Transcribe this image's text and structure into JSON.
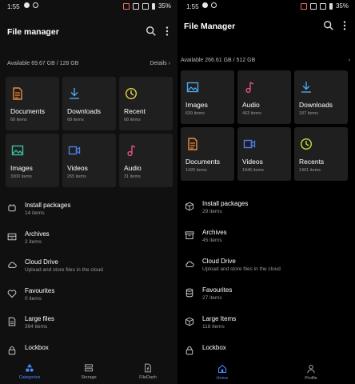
{
  "left": {
    "status": {
      "time": "1:55",
      "battery": "35%"
    },
    "title": "File manager",
    "storage": {
      "available": "Available 69.67 GB / 128 GB",
      "details": "Details ›"
    },
    "tiles": [
      {
        "label": "Documents",
        "count": "68 items",
        "icon": "document-icon",
        "color": "#f08a3a"
      },
      {
        "label": "Downloads",
        "count": "68 items",
        "icon": "download-icon",
        "color": "#4fa6e8"
      },
      {
        "label": "Recent",
        "count": "68 items",
        "icon": "clock-icon",
        "color": "#e3d44a"
      },
      {
        "label": "Images",
        "count": "3300 items",
        "icon": "image-icon",
        "color": "#3cc0a0"
      },
      {
        "label": "Videos",
        "count": "255 items",
        "icon": "video-icon",
        "color": "#4f7fe8"
      },
      {
        "label": "Audio",
        "count": "31 items",
        "icon": "music-icon",
        "color": "#e84f8a"
      }
    ],
    "list": [
      {
        "title": "Install packages",
        "sub": "14 items",
        "icon": "package-icon"
      },
      {
        "title": "Archives",
        "sub": "2 items",
        "icon": "archive-icon"
      },
      {
        "title": "Cloud Drive",
        "sub": "Upload and store files in the cloud",
        "icon": "cloud-icon"
      },
      {
        "title": "Favourites",
        "sub": "0 items",
        "icon": "heart-icon"
      },
      {
        "title": "Large files",
        "sub": "394 items",
        "icon": "file-icon"
      },
      {
        "title": "Lockbox",
        "sub": "",
        "icon": "lock-icon"
      }
    ],
    "nav": [
      {
        "label": "Categories",
        "icon": "categories-icon",
        "active": true
      },
      {
        "label": "Storage",
        "icon": "storage-icon",
        "active": false
      },
      {
        "label": "FileDash",
        "icon": "filedash-icon",
        "active": false
      }
    ]
  },
  "right": {
    "status": {
      "time": "1:55",
      "battery": "35%"
    },
    "title": "File Manager",
    "storage": {
      "available": "Available 266.61 GB / 512 GB",
      "details": "›"
    },
    "tiles": [
      {
        "label": "Images",
        "count": "639 items",
        "icon": "image-icon",
        "color": "#4fa6e8"
      },
      {
        "label": "Audio",
        "count": "463 items",
        "icon": "music-icon",
        "color": "#e84f8a"
      },
      {
        "label": "Downloads",
        "count": "187 items",
        "icon": "download-icon",
        "color": "#4fa6e8"
      },
      {
        "label": "Documents",
        "count": "1420 items",
        "icon": "document-icon",
        "color": "#f08a3a"
      },
      {
        "label": "Videos",
        "count": "1946 items",
        "icon": "video-icon",
        "color": "#4f7fe8"
      },
      {
        "label": "Recents",
        "count": "1461 items",
        "icon": "clock-icon",
        "color": "#c6e03a"
      }
    ],
    "list": [
      {
        "title": "Install packages",
        "sub": "29 items",
        "icon": "package-icon"
      },
      {
        "title": "Archives",
        "sub": "45 items",
        "icon": "archive-icon"
      },
      {
        "title": "Cloud Drive",
        "sub": "Upload and store files in the cloud",
        "icon": "cloud-icon"
      },
      {
        "title": "Favourites",
        "sub": "27 items",
        "icon": "database-icon"
      },
      {
        "title": "Large Items",
        "sub": "118 items",
        "icon": "package-icon"
      },
      {
        "title": "Lockbox",
        "sub": "",
        "icon": "lock-icon"
      }
    ],
    "nav": [
      {
        "label": "Home",
        "icon": "home-icon",
        "active": true
      },
      {
        "label": "Profile",
        "icon": "profile-icon",
        "active": false
      }
    ]
  }
}
